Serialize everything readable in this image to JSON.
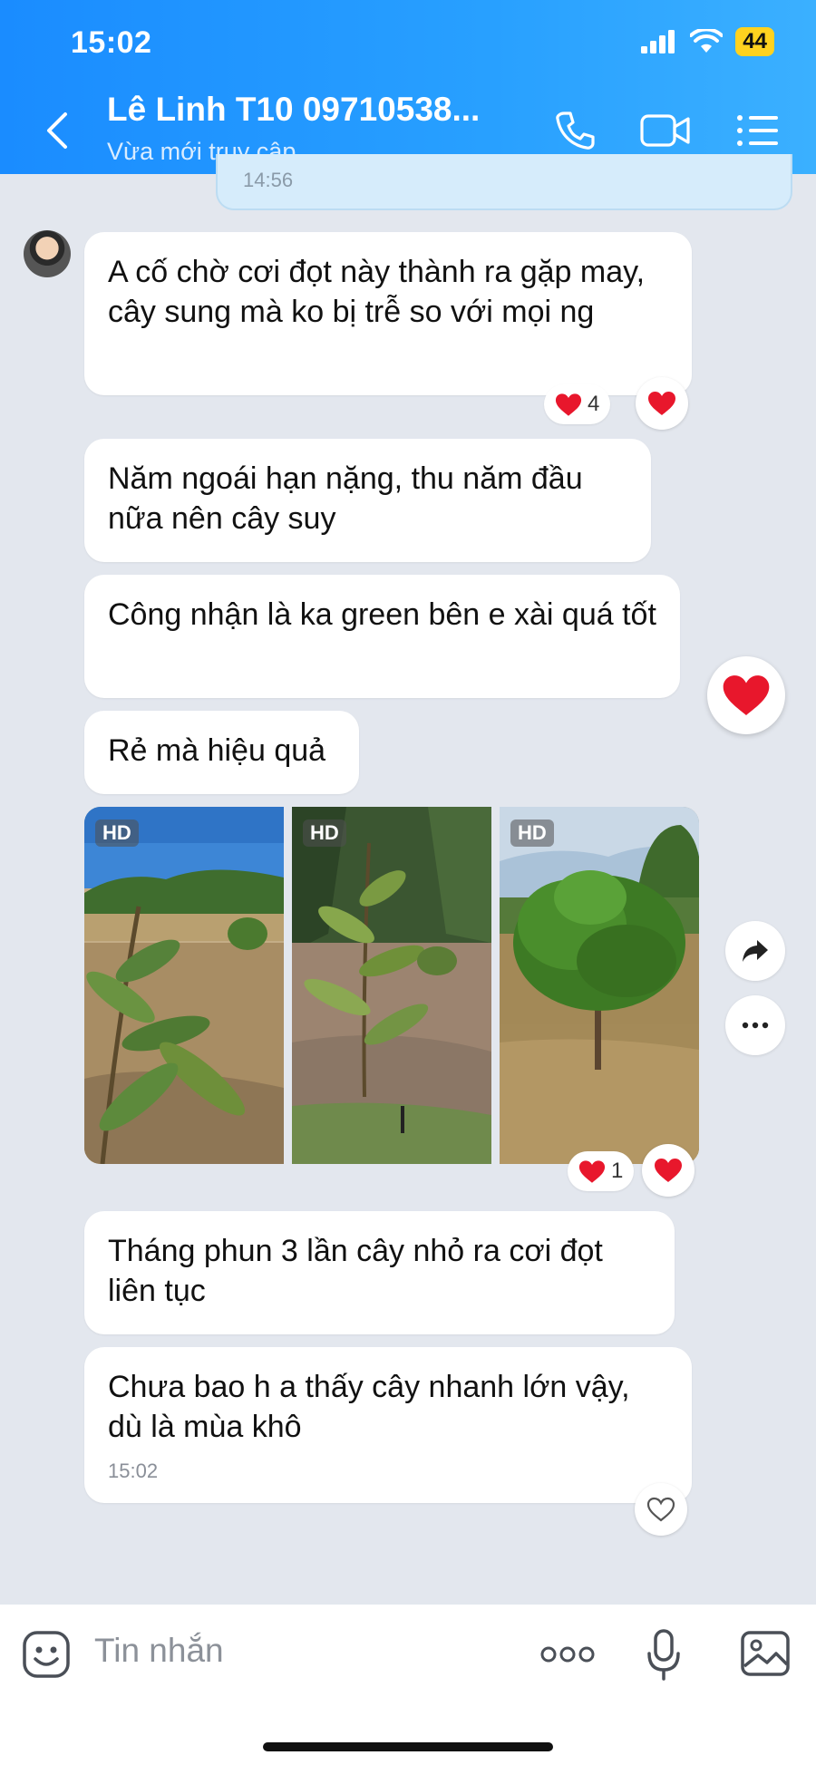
{
  "status_bar": {
    "time": "15:02",
    "battery": "44"
  },
  "header": {
    "title": "Lê Linh T10 09710538...",
    "subtitle": "Vừa mới truy cập"
  },
  "previous_message": {
    "time": "14:56"
  },
  "messages": [
    {
      "text": "A cố chờ cơi đọt này thành ra gặp may, cây sung mà ko bị trễ so với mọi ng",
      "reaction_count": "4"
    },
    {
      "text": "Năm ngoái hạn nặng, thu năm đầu nữa nên cây suy"
    },
    {
      "text": "Công nhận là ka green bên e xài quá tốt"
    },
    {
      "text": "Rẻ mà hiệu quả"
    },
    {
      "text": "Tháng phun 3 lần cây nhỏ ra cơi đọt liên tục"
    },
    {
      "text": "Chưa bao h a thấy cây nhanh lớn vậy, dù là mùa khô",
      "time": "15:02"
    }
  ],
  "photos": {
    "badge": "HD",
    "reaction_count": "1",
    "items": [
      "durian-sapling-1",
      "durian-sapling-2",
      "durian-tree-3"
    ]
  },
  "input": {
    "placeholder": "Tin nhắn"
  },
  "colors": {
    "header": "#1a8cff",
    "background": "#e3e7ee",
    "heart": "#e8172c",
    "battery": "#ffd21f"
  }
}
